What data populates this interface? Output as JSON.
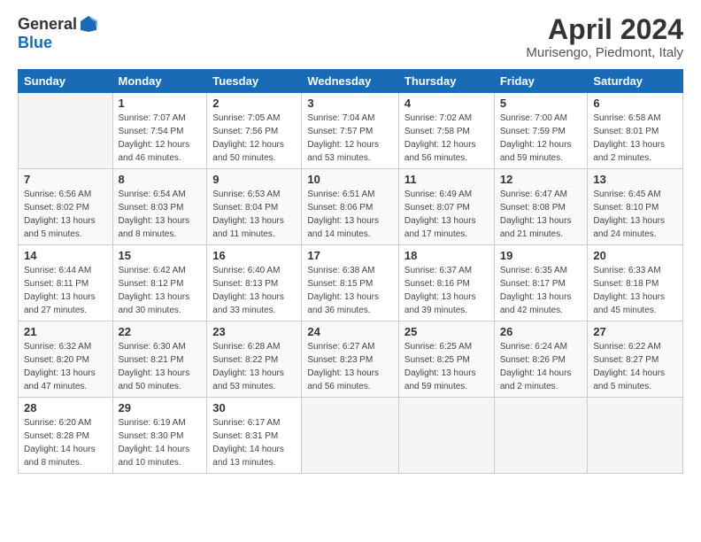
{
  "header": {
    "logo_general": "General",
    "logo_blue": "Blue",
    "title": "April 2024",
    "location": "Murisengo, Piedmont, Italy"
  },
  "calendar": {
    "days_of_week": [
      "Sunday",
      "Monday",
      "Tuesday",
      "Wednesday",
      "Thursday",
      "Friday",
      "Saturday"
    ],
    "weeks": [
      [
        {
          "day": "",
          "info": ""
        },
        {
          "day": "1",
          "info": "Sunrise: 7:07 AM\nSunset: 7:54 PM\nDaylight: 12 hours\nand 46 minutes."
        },
        {
          "day": "2",
          "info": "Sunrise: 7:05 AM\nSunset: 7:56 PM\nDaylight: 12 hours\nand 50 minutes."
        },
        {
          "day": "3",
          "info": "Sunrise: 7:04 AM\nSunset: 7:57 PM\nDaylight: 12 hours\nand 53 minutes."
        },
        {
          "day": "4",
          "info": "Sunrise: 7:02 AM\nSunset: 7:58 PM\nDaylight: 12 hours\nand 56 minutes."
        },
        {
          "day": "5",
          "info": "Sunrise: 7:00 AM\nSunset: 7:59 PM\nDaylight: 12 hours\nand 59 minutes."
        },
        {
          "day": "6",
          "info": "Sunrise: 6:58 AM\nSunset: 8:01 PM\nDaylight: 13 hours\nand 2 minutes."
        }
      ],
      [
        {
          "day": "7",
          "info": "Sunrise: 6:56 AM\nSunset: 8:02 PM\nDaylight: 13 hours\nand 5 minutes."
        },
        {
          "day": "8",
          "info": "Sunrise: 6:54 AM\nSunset: 8:03 PM\nDaylight: 13 hours\nand 8 minutes."
        },
        {
          "day": "9",
          "info": "Sunrise: 6:53 AM\nSunset: 8:04 PM\nDaylight: 13 hours\nand 11 minutes."
        },
        {
          "day": "10",
          "info": "Sunrise: 6:51 AM\nSunset: 8:06 PM\nDaylight: 13 hours\nand 14 minutes."
        },
        {
          "day": "11",
          "info": "Sunrise: 6:49 AM\nSunset: 8:07 PM\nDaylight: 13 hours\nand 17 minutes."
        },
        {
          "day": "12",
          "info": "Sunrise: 6:47 AM\nSunset: 8:08 PM\nDaylight: 13 hours\nand 21 minutes."
        },
        {
          "day": "13",
          "info": "Sunrise: 6:45 AM\nSunset: 8:10 PM\nDaylight: 13 hours\nand 24 minutes."
        }
      ],
      [
        {
          "day": "14",
          "info": "Sunrise: 6:44 AM\nSunset: 8:11 PM\nDaylight: 13 hours\nand 27 minutes."
        },
        {
          "day": "15",
          "info": "Sunrise: 6:42 AM\nSunset: 8:12 PM\nDaylight: 13 hours\nand 30 minutes."
        },
        {
          "day": "16",
          "info": "Sunrise: 6:40 AM\nSunset: 8:13 PM\nDaylight: 13 hours\nand 33 minutes."
        },
        {
          "day": "17",
          "info": "Sunrise: 6:38 AM\nSunset: 8:15 PM\nDaylight: 13 hours\nand 36 minutes."
        },
        {
          "day": "18",
          "info": "Sunrise: 6:37 AM\nSunset: 8:16 PM\nDaylight: 13 hours\nand 39 minutes."
        },
        {
          "day": "19",
          "info": "Sunrise: 6:35 AM\nSunset: 8:17 PM\nDaylight: 13 hours\nand 42 minutes."
        },
        {
          "day": "20",
          "info": "Sunrise: 6:33 AM\nSunset: 8:18 PM\nDaylight: 13 hours\nand 45 minutes."
        }
      ],
      [
        {
          "day": "21",
          "info": "Sunrise: 6:32 AM\nSunset: 8:20 PM\nDaylight: 13 hours\nand 47 minutes."
        },
        {
          "day": "22",
          "info": "Sunrise: 6:30 AM\nSunset: 8:21 PM\nDaylight: 13 hours\nand 50 minutes."
        },
        {
          "day": "23",
          "info": "Sunrise: 6:28 AM\nSunset: 8:22 PM\nDaylight: 13 hours\nand 53 minutes."
        },
        {
          "day": "24",
          "info": "Sunrise: 6:27 AM\nSunset: 8:23 PM\nDaylight: 13 hours\nand 56 minutes."
        },
        {
          "day": "25",
          "info": "Sunrise: 6:25 AM\nSunset: 8:25 PM\nDaylight: 13 hours\nand 59 minutes."
        },
        {
          "day": "26",
          "info": "Sunrise: 6:24 AM\nSunset: 8:26 PM\nDaylight: 14 hours\nand 2 minutes."
        },
        {
          "day": "27",
          "info": "Sunrise: 6:22 AM\nSunset: 8:27 PM\nDaylight: 14 hours\nand 5 minutes."
        }
      ],
      [
        {
          "day": "28",
          "info": "Sunrise: 6:20 AM\nSunset: 8:28 PM\nDaylight: 14 hours\nand 8 minutes."
        },
        {
          "day": "29",
          "info": "Sunrise: 6:19 AM\nSunset: 8:30 PM\nDaylight: 14 hours\nand 10 minutes."
        },
        {
          "day": "30",
          "info": "Sunrise: 6:17 AM\nSunset: 8:31 PM\nDaylight: 14 hours\nand 13 minutes."
        },
        {
          "day": "",
          "info": ""
        },
        {
          "day": "",
          "info": ""
        },
        {
          "day": "",
          "info": ""
        },
        {
          "day": "",
          "info": ""
        }
      ]
    ]
  }
}
